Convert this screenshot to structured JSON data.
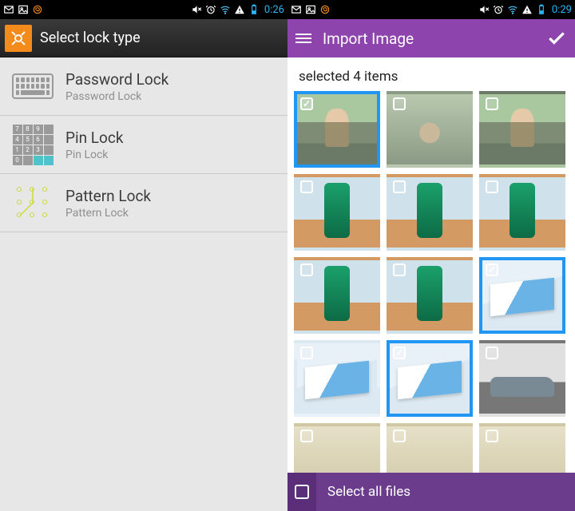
{
  "left": {
    "statusbar": {
      "time": "0:26",
      "icons": [
        "mail",
        "image",
        "swirl",
        "mute",
        "alarm",
        "wifi",
        "warn",
        "battery"
      ]
    },
    "appbar": {
      "title": "Select lock type"
    },
    "items": [
      {
        "title": "Password Lock",
        "subtitle": "Password Lock"
      },
      {
        "title": "Pin Lock",
        "subtitle": "Pin Lock"
      },
      {
        "title": "Pattern Lock",
        "subtitle": "Pattern Lock"
      }
    ]
  },
  "right": {
    "statusbar": {
      "time": "0:29",
      "icons": [
        "mail",
        "image",
        "swirl",
        "mute",
        "alarm",
        "wifi",
        "warn",
        "battery"
      ]
    },
    "appbar": {
      "title": "Import Image"
    },
    "selected_text": "selected 4 items",
    "grid": [
      [
        {
          "sel": true,
          "img": "person"
        },
        {
          "sel": false,
          "img": "person2"
        },
        {
          "sel": false,
          "img": "person"
        }
      ],
      [
        {
          "sel": false,
          "img": "wipes"
        },
        {
          "sel": false,
          "img": "wipes"
        },
        {
          "sel": false,
          "img": "wipes"
        }
      ],
      [
        {
          "sel": false,
          "img": "wipes"
        },
        {
          "sel": false,
          "img": "wipes"
        },
        {
          "sel": true,
          "img": "card"
        }
      ],
      [
        {
          "sel": false,
          "img": "card"
        },
        {
          "sel": true,
          "img": "card"
        },
        {
          "sel": false,
          "img": "car"
        }
      ],
      [
        {
          "sel": false,
          "img": "blur"
        },
        {
          "sel": false,
          "img": "blur"
        },
        {
          "sel": false,
          "img": "blur"
        }
      ]
    ],
    "footer": {
      "label": "Select all files"
    }
  }
}
